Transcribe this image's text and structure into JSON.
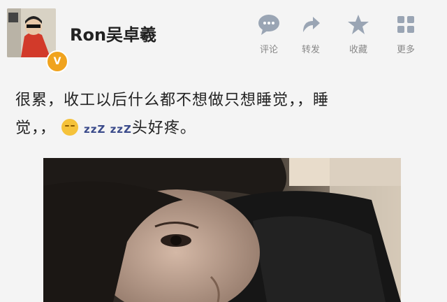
{
  "post": {
    "username": "Ron吴卓羲",
    "verified_badge": "V",
    "text_line1": "很累，收工以后什么都不想做只想睡觉，，睡",
    "text_line2_before": "觉，，",
    "text_zzz": "zzZ zzZ",
    "text_line2_after": "头好疼。"
  },
  "actions": [
    {
      "label": "评论",
      "icon": "comment-icon"
    },
    {
      "label": "转发",
      "icon": "repost-icon"
    },
    {
      "label": "收藏",
      "icon": "star-icon"
    },
    {
      "label": "更多",
      "icon": "more-grid-icon"
    }
  ],
  "colors": {
    "icon": "#9aa5b4",
    "badge": "#f0a31e",
    "background": "#f4f4f4"
  }
}
